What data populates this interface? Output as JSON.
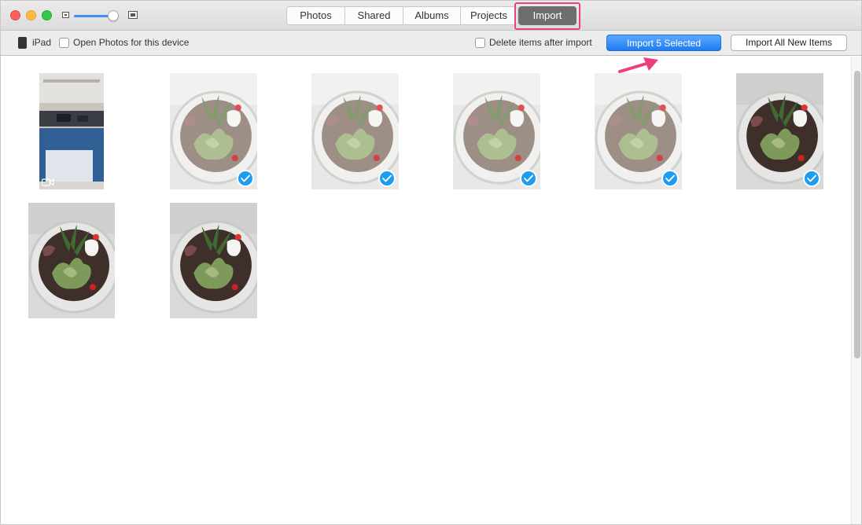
{
  "titlebar": {
    "tabs": [
      {
        "label": "Photos"
      },
      {
        "label": "Shared"
      },
      {
        "label": "Albums"
      },
      {
        "label": "Projects"
      }
    ],
    "active_tab": {
      "label": "Import"
    },
    "zoom_level": 0.9
  },
  "toolbar": {
    "device_label": "iPad",
    "open_photos_label": "Open Photos for this device",
    "open_photos_checked": false,
    "delete_items_label": "Delete items after import",
    "delete_items_checked": false,
    "import_selected_label": "Import 5 Selected",
    "import_all_label": "Import All New Items"
  },
  "colors": {
    "accent": "#1f9bf0",
    "highlight": "#ee3f7a"
  },
  "photos": [
    {
      "kind": "video",
      "selected": false
    },
    {
      "kind": "photo",
      "selected": true
    },
    {
      "kind": "photo",
      "selected": true
    },
    {
      "kind": "photo",
      "selected": true
    },
    {
      "kind": "photo",
      "selected": true
    },
    {
      "kind": "photo",
      "selected": true
    },
    {
      "kind": "photo",
      "selected": false
    },
    {
      "kind": "photo",
      "selected": false
    }
  ]
}
